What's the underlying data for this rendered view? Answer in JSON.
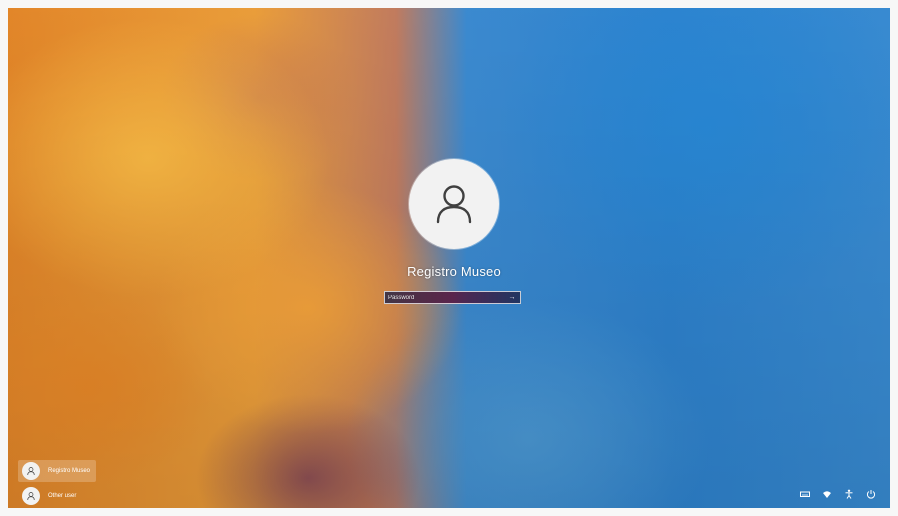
{
  "lock_screen": {
    "current_user": "Registro Museo",
    "password_placeholder": "Password",
    "submit_symbol": "→"
  },
  "user_switcher": {
    "users": [
      {
        "name": "Registro Museo",
        "selected": true
      },
      {
        "name": "Other user",
        "selected": false
      }
    ]
  },
  "system_tray": {
    "icons": [
      "keyboard-icon",
      "wifi-icon",
      "accessibility-icon",
      "power-icon"
    ]
  },
  "colors": {
    "avatar_bg": "#f2f2f2",
    "avatar_stroke": "#404040",
    "text": "#ffffff"
  }
}
